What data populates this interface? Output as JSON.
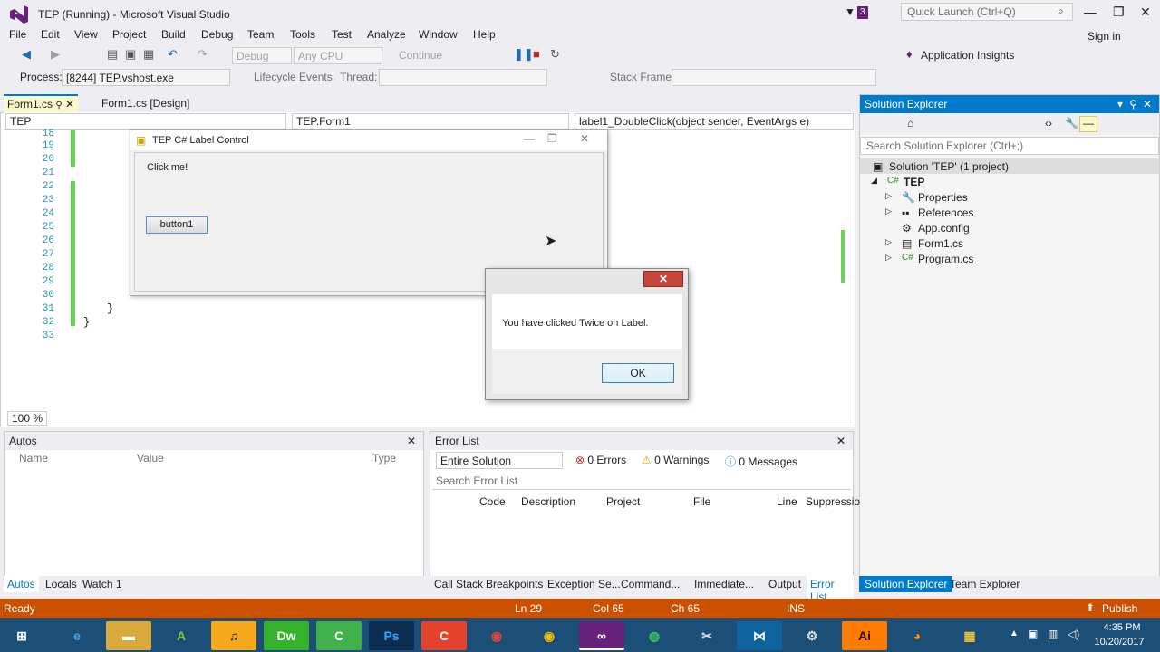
{
  "window": {
    "title": "TEP (Running) - Microsoft Visual Studio",
    "notif_count": "3",
    "quick_launch_placeholder": "Quick Launch (Ctrl+Q)",
    "sign_in": "Sign in"
  },
  "menu": [
    "File",
    "Edit",
    "View",
    "Project",
    "Build",
    "Debug",
    "Team",
    "Tools",
    "Test",
    "Analyze",
    "Window",
    "Help"
  ],
  "toolbar": {
    "config": "Debug",
    "platform": "Any CPU",
    "continue": "Continue",
    "app_insights": "Application Insights"
  },
  "debugbar": {
    "process_label": "Process:",
    "process_value": "[8244] TEP.vshost.exe",
    "lifecycle": "Lifecycle Events",
    "thread_label": "Thread:",
    "stack_label": "Stack Frame:"
  },
  "tabs": {
    "active": "Form1.cs",
    "design": "Form1.cs [Design]"
  },
  "navbar": {
    "project": "TEP",
    "class": "TEP.Form1",
    "member": "label1_DoubleClick(object sender, EventArgs e)"
  },
  "editor": {
    "lines": [
      "18",
      "19",
      "20",
      "21",
      "22",
      "23",
      "24",
      "25",
      "26",
      "27",
      "28",
      "29",
      "30",
      "31",
      "32",
      "33"
    ],
    "brace1": "}",
    "brace2": "}",
    "zoom": "100 %"
  },
  "form": {
    "title": "TEP C# Label Control",
    "label": "Click me!",
    "button": "button1"
  },
  "msgbox": {
    "text": "You have clicked Twice on Label.",
    "ok": "OK",
    "close": "✕"
  },
  "solution_explorer": {
    "title": "Solution Explorer",
    "search_placeholder": "Search Solution Explorer (Ctrl+;)",
    "solution": "Solution 'TEP' (1 project)",
    "project": "TEP",
    "items": [
      "Properties",
      "References",
      "App.config",
      "Form1.cs",
      "Program.cs"
    ],
    "tab1": "Solution Explorer",
    "tab2": "Team Explorer"
  },
  "autos": {
    "title": "Autos",
    "col_name": "Name",
    "col_value": "Value",
    "col_type": "Type",
    "tabs": [
      "Autos",
      "Locals",
      "Watch 1"
    ]
  },
  "errorlist": {
    "title": "Error List",
    "scope": "Entire Solution",
    "errors": "0 Errors",
    "warnings": "0 Warnings",
    "messages": "0 Messages",
    "search_placeholder": "Search Error List",
    "cols": [
      "Code",
      "Description",
      "Project",
      "File",
      "Line",
      "Suppressio"
    ],
    "tabs": [
      "Call Stack",
      "Breakpoints",
      "Exception Se...",
      "Command...",
      "Immediate...",
      "Output",
      "Error List"
    ]
  },
  "status": {
    "ready": "Ready",
    "ln": "Ln 29",
    "col": "Col 65",
    "ch": "Ch 65",
    "ins": "INS",
    "publish": "Publish"
  },
  "taskbar": {
    "time": "4:35 PM",
    "date": "10/20/2017"
  },
  "colors": {
    "accent": "#007acc",
    "status": "#ca5100",
    "taskbar": "#1b4f78"
  }
}
